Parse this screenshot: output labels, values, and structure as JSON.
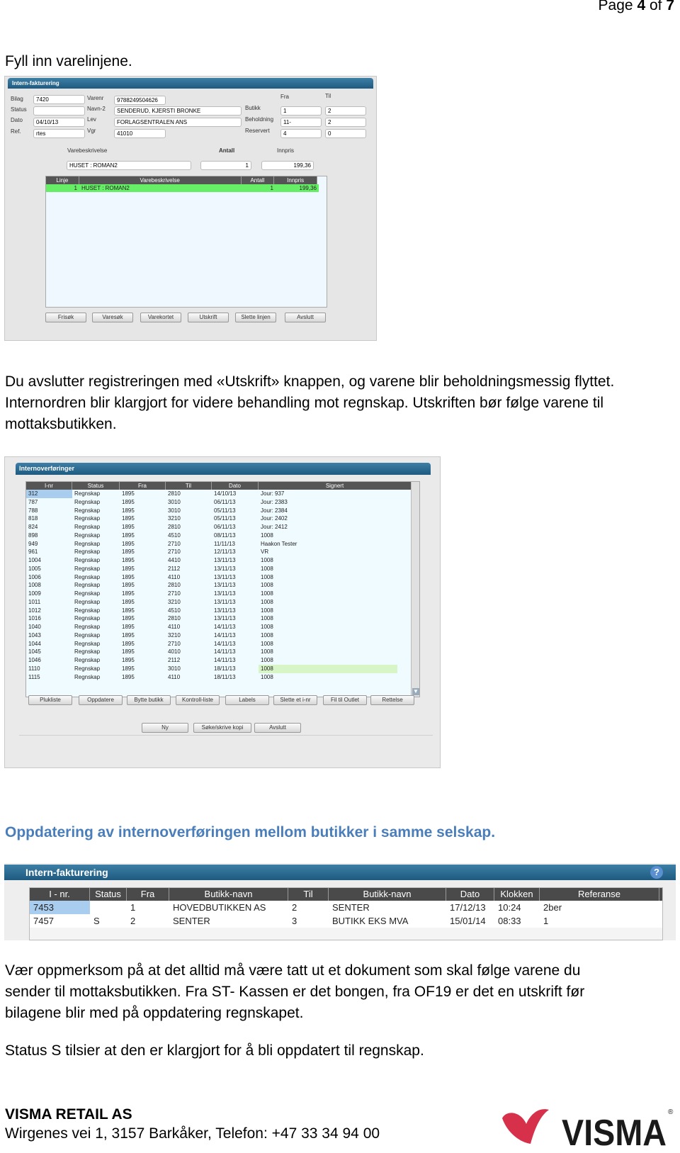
{
  "page": {
    "prefix": "Page ",
    "current": "4",
    "of": " of ",
    "total": "7"
  },
  "intro": "Fyll inn varelinjene.",
  "screen1": {
    "title": "Intern-fakturering",
    "fields": {
      "bilag_label": "Bilag",
      "bilag": "7420",
      "status_label": "Status",
      "status": "",
      "dato_label": "Dato",
      "dato": "04/10/13",
      "ref_label": "Ref.",
      "ref": "rtes",
      "varenr_label": "Varenr",
      "varenr": "9788249504626",
      "navn2_label": "Navn-2",
      "navn2": "SENDERUD, KJERSTI BRONKE",
      "lev_label": "Lev",
      "lev": "FORLAGSENTRALEN ANS",
      "vgr_label": "Vgr",
      "vgr": "41010",
      "fra_label": "Fra",
      "til_label": "Til",
      "butikk_label": "Butikk",
      "butikk_fra": "1",
      "butikk_til": "2",
      "beholdning_label": "Beholdning",
      "beholdning_fra": "11-",
      "beholdning_til": "2",
      "reservert_label": "Reservert",
      "reservert_fra": "4",
      "reservert_til": "0"
    },
    "entry": {
      "varebeskrivelse_label": "Varebeskrivelse",
      "varebeskrivelse": "HUSET : ROMAN2",
      "antall_label": "Antall",
      "antall": "1",
      "innpris_label": "Innpris",
      "innpris": "199,36"
    },
    "grid": {
      "columns": [
        "Linje",
        "Varebeskrivelse",
        "Antall",
        "Innpris"
      ],
      "rows": [
        [
          "1",
          "HUSET : ROMAN2",
          "1",
          "199,36"
        ]
      ],
      "highlight": "#66ee66"
    },
    "buttons": [
      "Frisøk",
      "Varesøk",
      "Varekortet",
      "Utskrift",
      "Slette linjen",
      "Avslutt"
    ]
  },
  "paragraph1": [
    "Du avslutter registreringen med «Utskrift» knappen, og varene blir beholdningsmessig flyttet.",
    "Internordren blir klargjort for videre behandling mot regnskap. Utskriften bør følge varene til",
    "mottaksbutikken."
  ],
  "screen2": {
    "title": "Internoverføringer",
    "columns": [
      "I-nr",
      "Status",
      "Fra",
      "Til",
      "Dato",
      "Signert"
    ],
    "rows": [
      [
        "312",
        "Regnskap",
        "1895",
        "2810",
        "14/10/13",
        "Jour: 937"
      ],
      [
        "787",
        "Regnskap",
        "1895",
        "3010",
        "06/11/13",
        "Jour: 2383"
      ],
      [
        "788",
        "Regnskap",
        "1895",
        "3010",
        "05/11/13",
        "Jour: 2384"
      ],
      [
        "818",
        "Regnskap",
        "1895",
        "3210",
        "05/11/13",
        "Jour: 2402"
      ],
      [
        "824",
        "Regnskap",
        "1895",
        "2810",
        "06/11/13",
        "Jour: 2412"
      ],
      [
        "898",
        "Regnskap",
        "1895",
        "4510",
        "08/11/13",
        "1008"
      ],
      [
        "949",
        "Regnskap",
        "1895",
        "2710",
        "11/11/13",
        "Haakon Tester"
      ],
      [
        "961",
        "Regnskap",
        "1895",
        "2710",
        "12/11/13",
        "VR"
      ],
      [
        "1004",
        "Regnskap",
        "1895",
        "4410",
        "13/11/13",
        "1008"
      ],
      [
        "1005",
        "Regnskap",
        "1895",
        "2112",
        "13/11/13",
        "1008"
      ],
      [
        "1006",
        "Regnskap",
        "1895",
        "4110",
        "13/11/13",
        "1008"
      ],
      [
        "1008",
        "Regnskap",
        "1895",
        "2810",
        "13/11/13",
        "1008"
      ],
      [
        "1009",
        "Regnskap",
        "1895",
        "2710",
        "13/11/13",
        "1008"
      ],
      [
        "1011",
        "Regnskap",
        "1895",
        "3210",
        "13/11/13",
        "1008"
      ],
      [
        "1012",
        "Regnskap",
        "1895",
        "4510",
        "13/11/13",
        "1008"
      ],
      [
        "1016",
        "Regnskap",
        "1895",
        "2810",
        "13/11/13",
        "1008"
      ],
      [
        "1040",
        "Regnskap",
        "1895",
        "4110",
        "14/11/13",
        "1008"
      ],
      [
        "1043",
        "Regnskap",
        "1895",
        "3210",
        "14/11/13",
        "1008"
      ],
      [
        "1044",
        "Regnskap",
        "1895",
        "2710",
        "14/11/13",
        "1008"
      ],
      [
        "1045",
        "Regnskap",
        "1895",
        "4010",
        "14/11/13",
        "1008"
      ],
      [
        "1046",
        "Regnskap",
        "1895",
        "2112",
        "14/11/13",
        "1008"
      ],
      [
        "1110",
        "Regnskap",
        "1895",
        "3010",
        "18/11/13",
        "1008"
      ],
      [
        "1115",
        "Regnskap",
        "1895",
        "4110",
        "18/11/13",
        "1008"
      ]
    ],
    "buttons_row1": [
      "Plukliste",
      "Oppdatere",
      "Bytte butikk",
      "Kontroll-liste",
      "Labels",
      "Slette et i-nr",
      "Fil til Outlet",
      "Rettelse"
    ],
    "buttons_row2": [
      "Ny",
      "Søke/skrive kopi",
      "Avslutt"
    ]
  },
  "heading": "Oppdatering av internoverføringen mellom butikker i samme selskap.",
  "screen3": {
    "title": "Intern-fakturering",
    "help_icon": "?",
    "columns": [
      "I - nr.",
      "Status",
      "Fra",
      "Butikk-navn",
      "Til",
      "Butikk-navn",
      "Dato",
      "Klokken",
      "Referanse"
    ],
    "rows": [
      [
        "7453",
        "",
        "1",
        "HOVEDBUTIKKEN AS",
        "2",
        "SENTER",
        "17/12/13",
        "10:24",
        "2ber"
      ],
      [
        "7457",
        "S",
        "2",
        "SENTER",
        "3",
        "BUTIKK EKS MVA",
        "15/01/14",
        "08:33",
        "1"
      ]
    ]
  },
  "paragraph2": [
    "Vær oppmerksom på at det alltid må være tatt ut et dokument som skal følge varene du",
    "sender til mottaksbutikken. Fra ST- Kassen er det bongen, fra OF19 er det en utskrift før",
    "bilagene blir med på oppdatering regnskapet."
  ],
  "paragraph3": "Status S tilsier at den er klargjort for å bli oppdatert til regnskap.",
  "footer": {
    "company": "VISMA RETAIL AS",
    "address": "Wirgenes vei 1, 3157 Barkåker, Telefon: +47 33 34 94 00",
    "logo_text": "VISMA"
  },
  "colors": {
    "heading": "#4a7ebb",
    "selection": "#a8cdef",
    "row_highlight": "#d8f5c8",
    "logo_red": "#d6304a"
  }
}
